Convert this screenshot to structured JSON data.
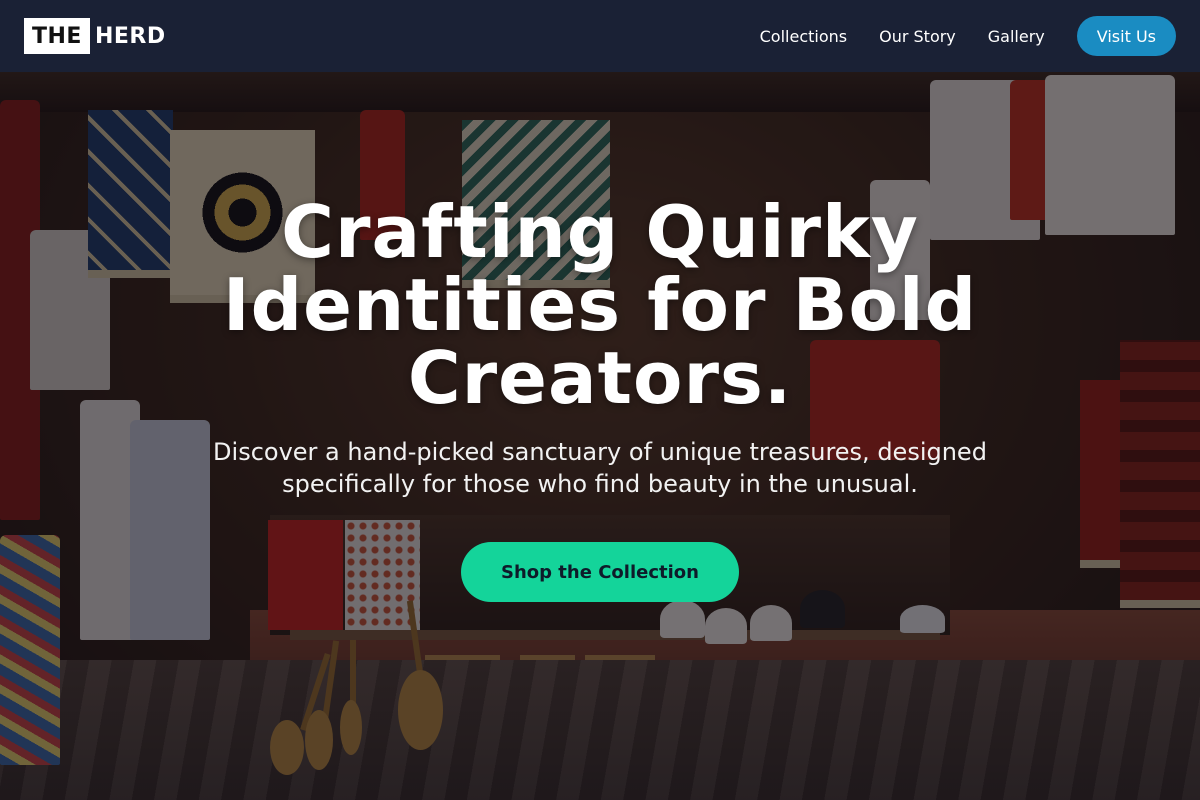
{
  "brand": {
    "logo_box": "THE",
    "logo_rest": "HERD"
  },
  "nav": {
    "links": [
      "Collections",
      "Our Story",
      "Gallery"
    ],
    "cta_label": "Visit Us"
  },
  "hero": {
    "title": "Crafting Quirky Identities for Bold Creators.",
    "subtitle": "Discover a hand-picked sanctuary of unique treasures, designed specifically for those who find beauty in the unusual.",
    "cta_label": "Shop the Collection"
  },
  "colors": {
    "nav_bg": "#1a2135",
    "visit_button": "#1a8cc2",
    "cta_button": "#14d49a",
    "cta_text": "#0e1b2a"
  }
}
